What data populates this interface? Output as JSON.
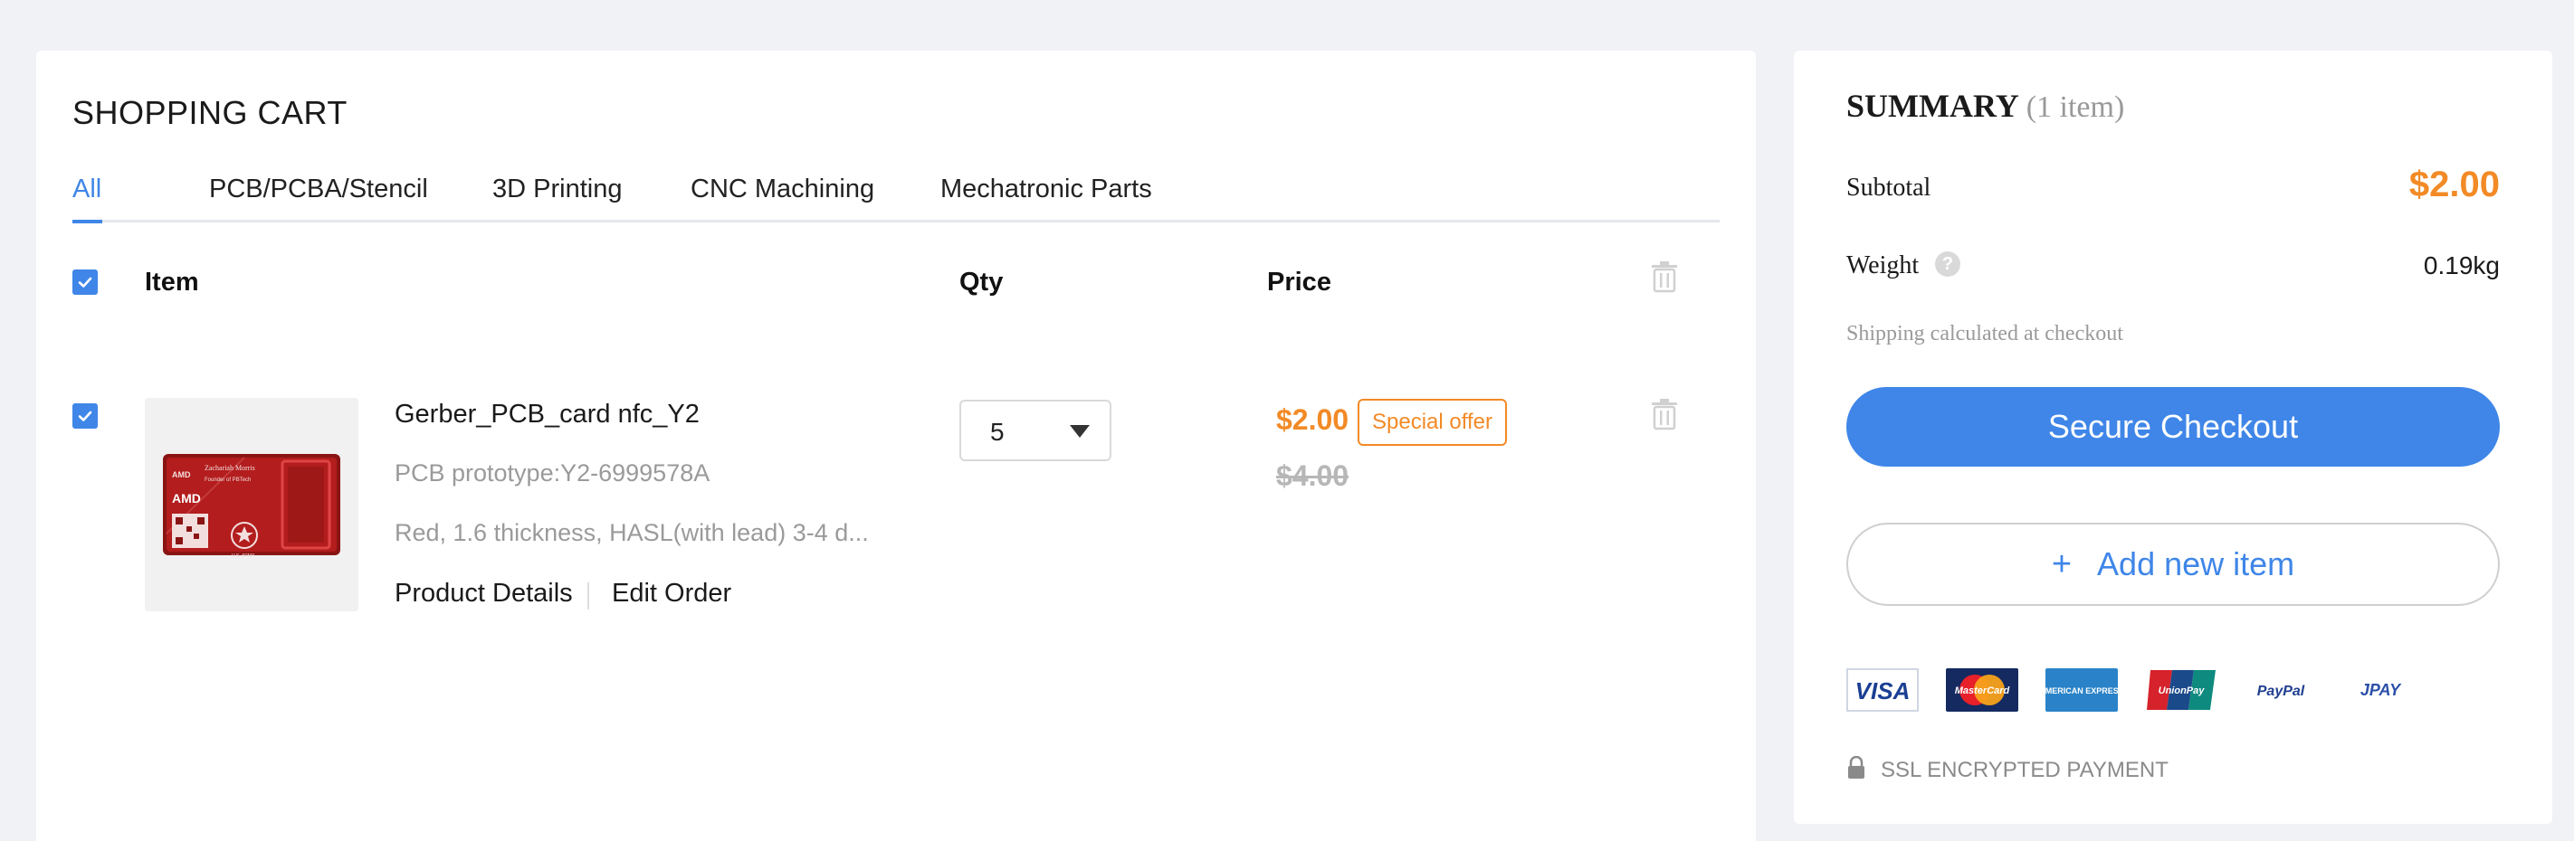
{
  "cart": {
    "title": "SHOPPING CART",
    "tabs": [
      {
        "label": "All",
        "active": true
      },
      {
        "label": "PCB/PCBA/Stencil",
        "active": false
      },
      {
        "label": "3D Printing",
        "active": false
      },
      {
        "label": "CNC Machining",
        "active": false
      },
      {
        "label": "Mechatronic Parts",
        "active": false
      }
    ],
    "columns": {
      "item": "Item",
      "qty": "Qty",
      "price": "Price"
    },
    "items": [
      {
        "checked": true,
        "name": "Gerber_PCB_card nfc_Y2",
        "subtitle": "PCB prototype:Y2-6999578A",
        "description": "Red, 1.6 thickness, HASL(with lead) 3-4 d...",
        "links": {
          "details": "Product Details",
          "edit": "Edit Order"
        },
        "qty": "5",
        "price": "$2.00",
        "badge": "Special offer",
        "old_price": "$4.00",
        "thumbnail_text": {
          "name": "Zachariah Morris",
          "role": "Founder of PBTech",
          "brand": "AMD",
          "org": "U.S. ARMY"
        }
      }
    ]
  },
  "summary": {
    "title": "SUMMARY",
    "count": "(1 item)",
    "subtotal_label": "Subtotal",
    "subtotal": "$2.00",
    "weight_label": "Weight",
    "weight": "0.19kg",
    "help_icon": "?",
    "shipping_note": "Shipping calculated at checkout",
    "checkout_label": "Secure Checkout",
    "add_item_plus": "+",
    "add_item_label": "Add new item",
    "payment_methods": [
      "VISA",
      "MasterCard",
      "AMERICAN EXPRESS",
      "UnionPay",
      "PayPal",
      "JPAY"
    ],
    "ssl_text": "SSL ENCRYPTED PAYMENT"
  },
  "colors": {
    "accent": "#3f86e8",
    "price": "#f28a26",
    "muted": "#9a9a9a",
    "background": "#f1f2f6"
  }
}
